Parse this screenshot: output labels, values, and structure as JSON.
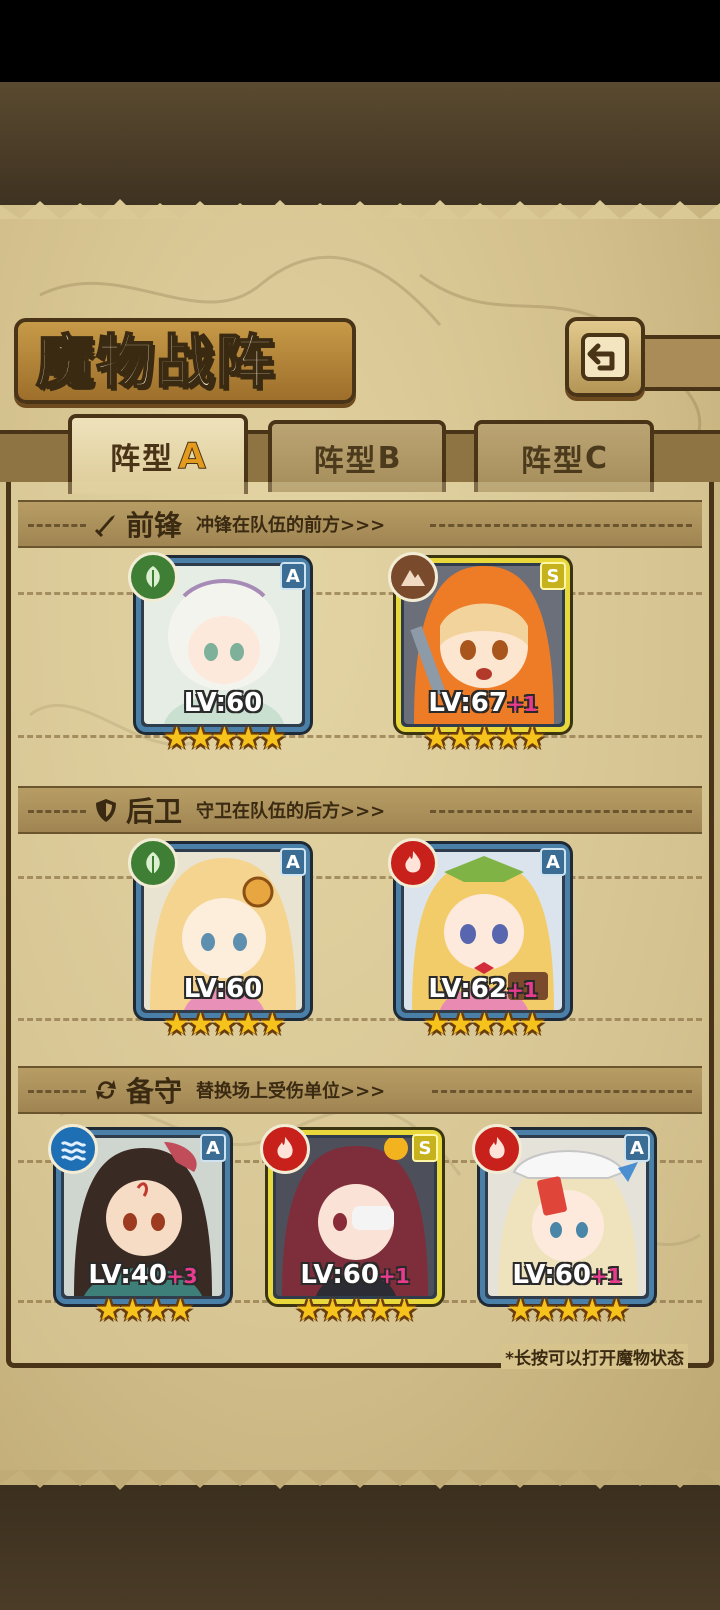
{
  "title": "魔物战阵",
  "back_button": {
    "icon": "return-icon"
  },
  "tabs": [
    {
      "label": "阵型",
      "letter": "A",
      "active": true
    },
    {
      "label": "阵型",
      "letter": "B",
      "active": false
    },
    {
      "label": "阵型",
      "letter": "C",
      "active": false
    }
  ],
  "sections": {
    "front": {
      "name": "前锋",
      "desc": "冲锋在队伍的前方>>>",
      "icon": "sword-icon"
    },
    "rear": {
      "name": "后卫",
      "desc": "守卫在队伍的后方>>>",
      "icon": "shield-icon"
    },
    "reserve": {
      "name": "备守",
      "desc": "替换场上受伤单位>>>",
      "icon": "swap-icon"
    }
  },
  "cards": {
    "front_1": {
      "rank": "A",
      "element": "nature",
      "lv": "LV:60",
      "plus": "",
      "stars": "★★★★★"
    },
    "front_2": {
      "rank": "S",
      "element": "earth",
      "lv": "LV:67",
      "plus": "+1",
      "stars": "★★★★★"
    },
    "rear_1": {
      "rank": "A",
      "element": "nature",
      "lv": "LV:60",
      "plus": "",
      "stars": "★★★★★"
    },
    "rear_2": {
      "rank": "A",
      "element": "fire",
      "lv": "LV:62",
      "plus": "+1",
      "stars": "★★★★★"
    },
    "reserve_1": {
      "rank": "A",
      "element": "water",
      "lv": "LV:40",
      "plus": "+3",
      "stars": "★★★★"
    },
    "reserve_2": {
      "rank": "S",
      "element": "fire",
      "lv": "LV:60",
      "plus": "+1",
      "stars": "★★★★★"
    },
    "reserve_3": {
      "rank": "A",
      "element": "fire",
      "lv": "LV:60",
      "plus": "+1",
      "stars": "★★★★★"
    }
  },
  "footnote": "*长按可以打开魔物状态",
  "colors": {
    "rank_a": "#3b6d94",
    "rank_s": "#c6b21c",
    "nature": "#3f7f35",
    "earth": "#7a4a2c",
    "fire": "#c8211b",
    "water": "#1f6fb5",
    "star": "#f6c21c",
    "plus": "#e83b8d"
  }
}
